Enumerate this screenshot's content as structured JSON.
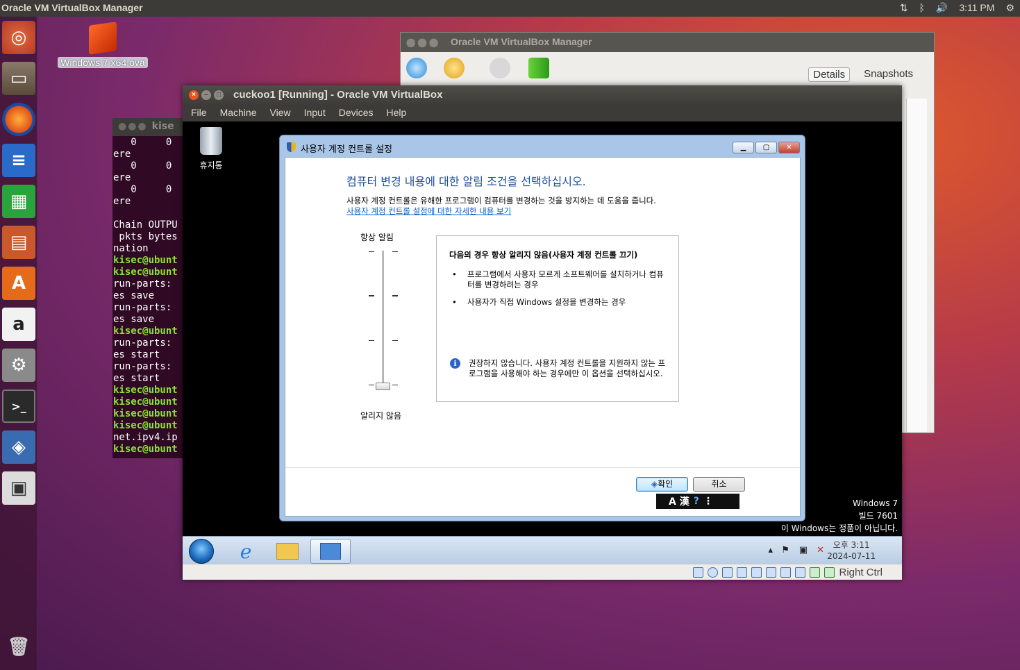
{
  "top_panel": {
    "app_title": "Oracle VM VirtualBox Manager",
    "time": "3:11 PM",
    "icons": [
      "network-icon",
      "bluetooth-icon",
      "volume-icon",
      "gear-icon"
    ]
  },
  "launcher": {
    "items": [
      "ubuntu-dash",
      "files",
      "firefox",
      "writer",
      "calc",
      "impress",
      "software-center",
      "amazon",
      "system-settings",
      "terminal",
      "virtualbox",
      "save",
      "trash"
    ]
  },
  "desktop": {
    "file_label": "Windows 7 x64.ova"
  },
  "terminal": {
    "title": "kise",
    "lines": [
      {
        "t": "   0     0",
        "g": false
      },
      {
        "t": "ere",
        "g": false
      },
      {
        "t": "   0     0",
        "g": false
      },
      {
        "t": "ere",
        "g": false
      },
      {
        "t": "   0     0",
        "g": false
      },
      {
        "t": "ere",
        "g": false
      },
      {
        "t": "",
        "g": false
      },
      {
        "t": "Chain OUTPU",
        "g": false
      },
      {
        "t": " pkts bytes",
        "g": false
      },
      {
        "t": "nation",
        "g": false
      },
      {
        "t": "kisec@ubunt",
        "g": true
      },
      {
        "t": "kisec@ubunt",
        "g": true
      },
      {
        "t": "run-parts: ",
        "g": false
      },
      {
        "t": "es save",
        "g": false
      },
      {
        "t": "run-parts: ",
        "g": false
      },
      {
        "t": "es save",
        "g": false
      },
      {
        "t": "kisec@ubunt",
        "g": true
      },
      {
        "t": "run-parts: ",
        "g": false
      },
      {
        "t": "es start",
        "g": false
      },
      {
        "t": "run-parts: ",
        "g": false
      },
      {
        "t": "es start",
        "g": false
      },
      {
        "t": "kisec@ubunt",
        "g": true
      },
      {
        "t": "kisec@ubunt",
        "g": true
      },
      {
        "t": "kisec@ubunt",
        "g": true
      },
      {
        "t": "kisec@ubunt",
        "g": true
      },
      {
        "t": "net.ipv4.ip",
        "g": false
      },
      {
        "t": "kisec@ubunt",
        "g": true
      }
    ]
  },
  "vbox_manager": {
    "title": "Oracle VM VirtualBox Manager",
    "tab_details": "Details",
    "tab_snapshots": "Snapshots"
  },
  "vm_window": {
    "title": "cuckoo1 [Running] - Oracle VM VirtualBox",
    "menu": [
      "File",
      "Machine",
      "View",
      "Input",
      "Devices",
      "Help"
    ],
    "host_key": "Right Ctrl"
  },
  "guest": {
    "recycle_bin": "휴지통",
    "watermark": {
      "line1": "Windows 7",
      "line2": "빌드 7601",
      "line3": "이 Windows는 정품이 아닙니다."
    },
    "clock": {
      "time": "오후 3:11",
      "date": "2024-07-11"
    }
  },
  "uac": {
    "title": "사용자 계정 컨트롤 설정",
    "heading": "컴퓨터 변경 내용에 대한 알림 조건을 선택하십시오.",
    "description": "사용자 계정 컨트롤은 유해한 프로그램이 컴퓨터를 변경하는 것을 방지하는 데 도움을 줍니다.",
    "link": "사용자 계정 컨트롤 설정에 대한 자세한 내용 보기",
    "slider_top": "항상 알림",
    "slider_bottom": "알리지 않음",
    "slider_level": 0,
    "info_title": "다음의 경우 항상 알리지 않음(사용자 계정 컨트롤 끄기)",
    "bullet1": "프로그램에서 사용자 모르게 소프트웨어를 설치하거나 컴퓨터를 변경하려는 경우",
    "bullet2": "사용자가 직접 Windows 설정을 변경하는 경우",
    "warning": "권장하지 않습니다. 사용자 계정 컨트롤을 지원하지 않는 프로그램을 사용해야 하는 경우에만 이 옵션을 선택하십시오.",
    "ok": "확인",
    "cancel": "취소",
    "ime": "A 漢"
  }
}
